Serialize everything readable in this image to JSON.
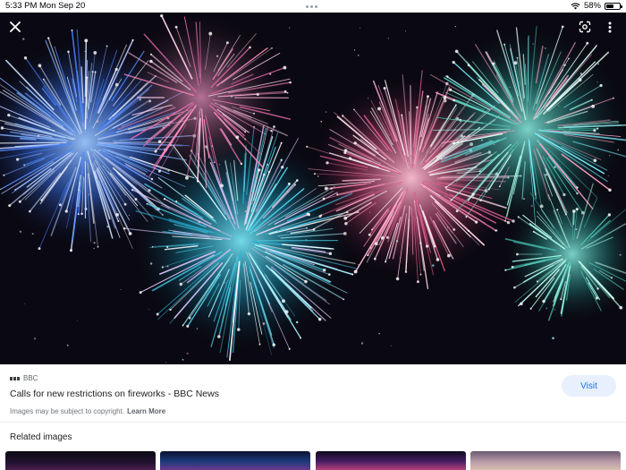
{
  "status_bar": {
    "time": "5:33 PM",
    "date": "Mon Sep 20",
    "battery_text": "58%",
    "battery_level": 0.58
  },
  "viewer": {
    "close_icon": "close-icon",
    "lens_icon": "google-lens-icon",
    "more_icon": "more-vert-icon"
  },
  "result": {
    "source_name": "BBC",
    "title": "Calls for new restrictions on fireworks - BBC News",
    "visit_label": "Visit",
    "copyright_text": "Images may be subject to copyright.",
    "learn_more": "Learn More"
  },
  "related": {
    "heading": "Related images"
  },
  "colors": {
    "accent": "#1a73e8",
    "visit_bg": "#e8f0fe",
    "image_bg": "#0a0812"
  }
}
